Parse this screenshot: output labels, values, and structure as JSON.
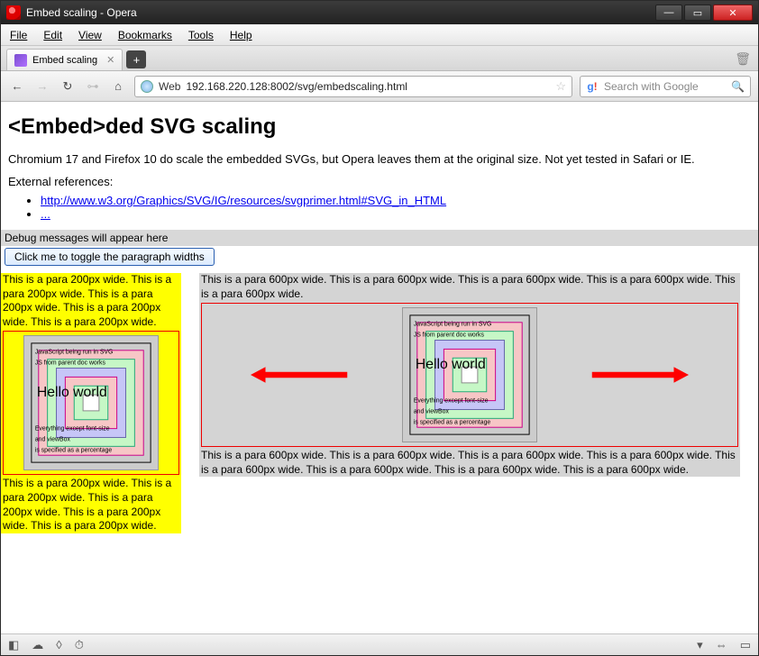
{
  "window": {
    "title": "Embed scaling - Opera"
  },
  "menu": {
    "file": "File",
    "edit": "Edit",
    "view": "View",
    "bookmarks": "Bookmarks",
    "tools": "Tools",
    "help": "Help"
  },
  "tab": {
    "title": "Embed scaling"
  },
  "toolbar": {
    "web_label": "Web",
    "url_value": "192.168.220.128:8002/svg/embedscaling.html",
    "search_placeholder": "Search with Google"
  },
  "page": {
    "heading": "<Embed>ded SVG scaling",
    "intro": "Chromium 17 and Firefox 10 do scale the embedded SVGs, but Opera leaves them at the original size. Not yet tested in Safari or IE.",
    "extref_label": "External references:",
    "link1_text": "http://www.w3.org/Graphics/SVG/IG/resources/svgprimer.html#SVG_in_HTML",
    "link2_text": "...",
    "debug_text": "Debug messages will appear here",
    "toggle_label": "Click me to toggle the paragraph widths",
    "para200": "This is a para 200px wide. This is a para 200px wide. This is a para 200px wide. This is a para 200px wide. This is a para 200px wide.",
    "para600_top": "This is a para 600px wide. This is a para 600px wide. This is a para 600px wide. This is a para 600px wide. This is a para 600px wide.",
    "para600_bottom": "This is a para 600px wide. This is a para 600px wide. This is a para 600px wide. This is a para 600px wide. This is a para 600px wide. This is a para 600px wide. This is a para 600px wide. This is a para 600px wide.",
    "svg_texts": {
      "l1": "JavaScript being run in SVG",
      "l2": "JS from parent doc works",
      "hello": "Hello world",
      "l3": "Everything except font-size",
      "l4": "and viewBox",
      "l5": "is specified as a percentage"
    }
  }
}
